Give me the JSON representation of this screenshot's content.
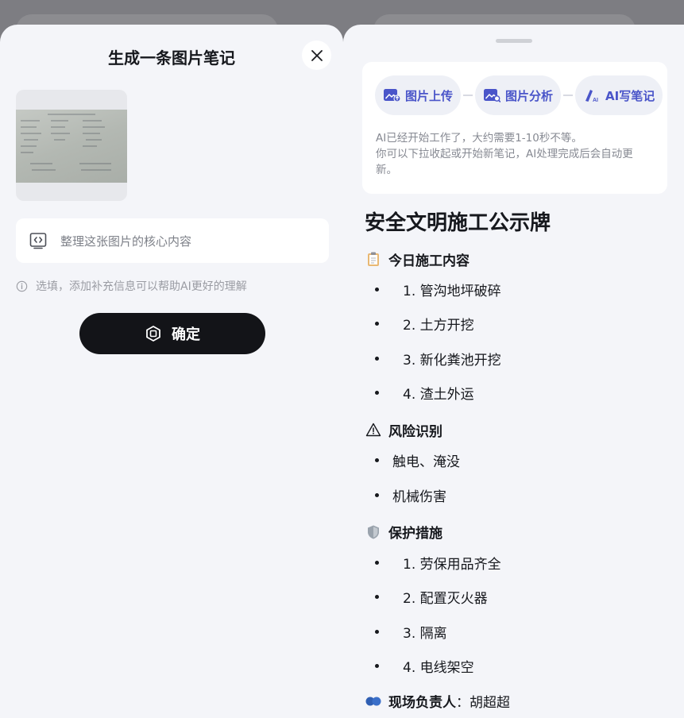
{
  "left_panel": {
    "title": "生成一条图片笔记",
    "prompt_placeholder": "整理这张图片的核心内容",
    "hint": "选填，添加补充信息可以帮助AI更好的理解",
    "confirm_label": "确定"
  },
  "right_panel": {
    "steps": [
      {
        "label": "图片上传",
        "icon": "image-upload-icon"
      },
      {
        "label": "图片分析",
        "icon": "image-analyze-icon"
      },
      {
        "label": "AI写笔记",
        "icon": "ai-pen-icon"
      }
    ],
    "status_line1": "AI已经开始工作了，大约需要1-10秒不等。",
    "status_line2": "你可以下拉收起或开始新笔记，AI处理完成后会自动更新。",
    "note": {
      "title": "安全文明施工公示牌",
      "sections": [
        {
          "emoji": "📋",
          "heading": "今日施工内容",
          "items": [
            "1. 管沟地坪破碎",
            "2. 土方开挖",
            "3. 新化粪池开挖",
            "4. 渣土外运"
          ]
        },
        {
          "emoji": "⚠",
          "heading": "风险识别",
          "items": [
            "触电、淹没",
            "机械伤害"
          ]
        },
        {
          "emoji": "🛡",
          "heading": "保护措施",
          "items": [
            "1. 劳保用品齐全",
            "2. 配置灭火器",
            "3. 隔离",
            "4. 电线架空"
          ]
        }
      ],
      "footer": {
        "emoji": "👥",
        "label": "现场负责人",
        "value": "胡超超"
      }
    }
  },
  "colors": {
    "accent": "#4a55c9",
    "button_dark": "#131418",
    "sheet_bg": "#f4f5f9"
  }
}
